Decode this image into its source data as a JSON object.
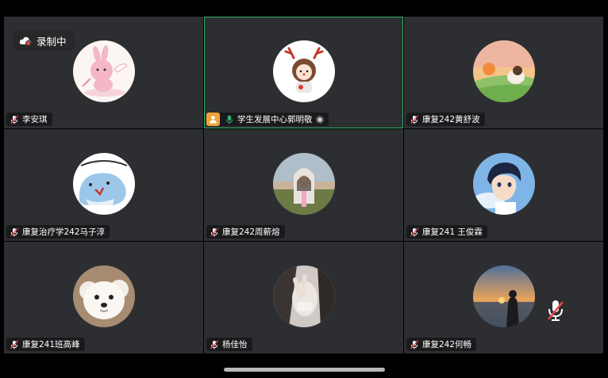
{
  "recording": {
    "label": "录制中"
  },
  "participants": [
    {
      "name": "李安琪",
      "muted": true,
      "avatar_icon": "pink-bunny-angel-avatar"
    },
    {
      "name": "学生发展中心郭明敬",
      "muted": false,
      "host": true,
      "speaking": true,
      "avatar_icon": "reindeer-girl-avatar"
    },
    {
      "name": "康复242黄舒波",
      "muted": true,
      "avatar_icon": "sunset-cat-avatar"
    },
    {
      "name": "康复治疗学242马子淳",
      "muted": true,
      "avatar_icon": "blue-shark-avatar"
    },
    {
      "name": "康复242周薪熔",
      "muted": true,
      "avatar_icon": "girl-hat-photo-avatar"
    },
    {
      "name": "康复241 王俊霖",
      "muted": true,
      "avatar_icon": "anime-boy-avatar"
    },
    {
      "name": "康复241班高峰",
      "muted": true,
      "avatar_icon": "white-dog-avatar"
    },
    {
      "name": "杨佳怡",
      "muted": true,
      "avatar_icon": "peace-sign-photo-avatar"
    },
    {
      "name": "康复242何畅",
      "muted": true,
      "avatar_icon": "sunset-silhouette-avatar"
    }
  ],
  "colors": {
    "tile_bg": "#2d2e31",
    "active_border": "#2fb36a",
    "record_dot": "#e5484d",
    "host_badge": "#f0a33a"
  }
}
